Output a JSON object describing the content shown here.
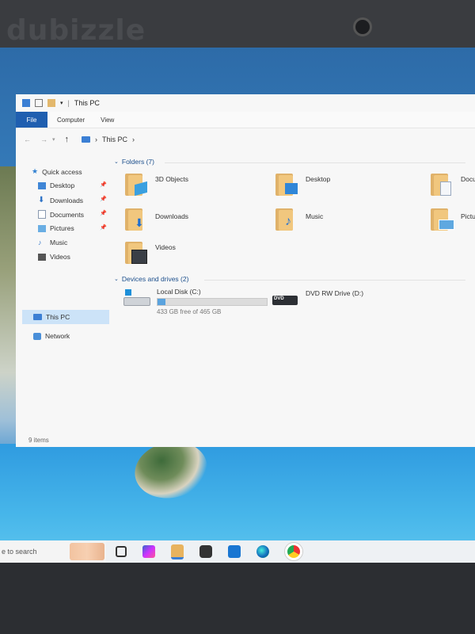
{
  "window": {
    "title": "This PC"
  },
  "ribbon": {
    "tabs": [
      "File",
      "Computer",
      "View"
    ]
  },
  "address": {
    "path": "This PC"
  },
  "nav": {
    "quick_access": "Quick access",
    "items": [
      "Desktop",
      "Downloads",
      "Documents",
      "Pictures",
      "Music",
      "Videos"
    ],
    "this_pc": "This PC",
    "network": "Network"
  },
  "folders": {
    "header": "Folders (7)",
    "items": [
      "3D Objects",
      "Desktop",
      "Docu",
      "Downloads",
      "Music",
      "Pictur",
      "Videos"
    ]
  },
  "drives": {
    "header": "Devices and drives (2)",
    "local_disk": {
      "name": "Local Disk (C:)",
      "free_text": "433 GB free of 465 GB",
      "used_fraction": 0.07
    },
    "dvd": {
      "name": "DVD RW Drive (D:)",
      "badge": "DVD"
    }
  },
  "status": {
    "items": "9 items"
  },
  "taskbar": {
    "search": "e to search"
  },
  "watermark": "dubizzle",
  "colors": {
    "accent": "#1f5fb0",
    "selection": "#cce3f8",
    "folder": "#f1c77e"
  }
}
